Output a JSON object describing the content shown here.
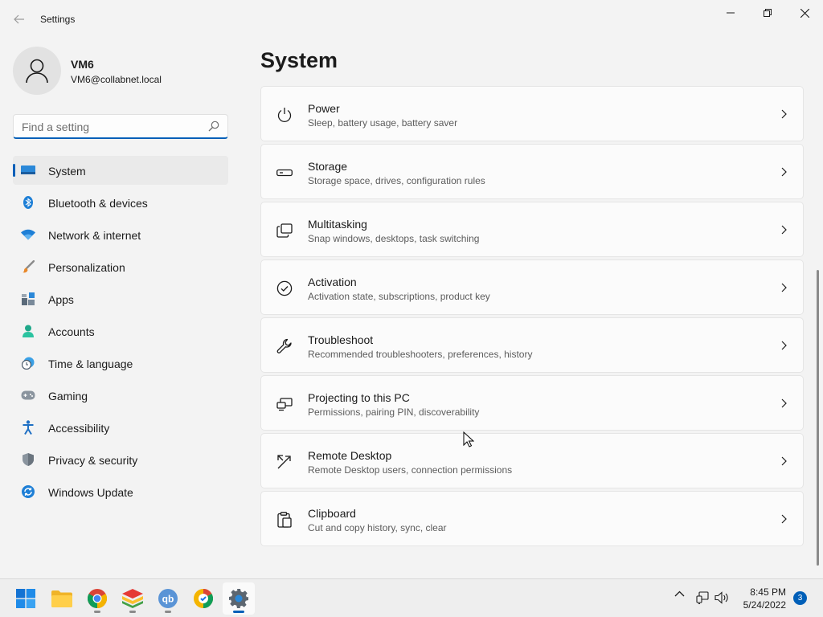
{
  "window": {
    "title": "Settings",
    "controls": {
      "minimize_icon": "minimize-icon",
      "maximize_icon": "restore-icon",
      "close_icon": "close-icon"
    }
  },
  "profile": {
    "name": "VM6",
    "email": "VM6@collabnet.local"
  },
  "search": {
    "placeholder": "Find a setting",
    "value": ""
  },
  "sidebar": {
    "selected_index": 0,
    "items": [
      {
        "label": "System",
        "icon": "system-icon"
      },
      {
        "label": "Bluetooth & devices",
        "icon": "bluetooth-icon"
      },
      {
        "label": "Network & internet",
        "icon": "wifi-icon"
      },
      {
        "label": "Personalization",
        "icon": "brush-icon"
      },
      {
        "label": "Apps",
        "icon": "apps-icon"
      },
      {
        "label": "Accounts",
        "icon": "account-icon"
      },
      {
        "label": "Time & language",
        "icon": "clock-globe-icon"
      },
      {
        "label": "Gaming",
        "icon": "gamepad-icon"
      },
      {
        "label": "Accessibility",
        "icon": "accessibility-icon"
      },
      {
        "label": "Privacy & security",
        "icon": "shield-icon"
      },
      {
        "label": "Windows Update",
        "icon": "update-icon"
      }
    ]
  },
  "main": {
    "title": "System",
    "cards": [
      {
        "title": "Power",
        "description": "Sleep, battery usage, battery saver",
        "icon": "power-icon"
      },
      {
        "title": "Storage",
        "description": "Storage space, drives, configuration rules",
        "icon": "storage-icon"
      },
      {
        "title": "Multitasking",
        "description": "Snap windows, desktops, task switching",
        "icon": "multitasking-icon"
      },
      {
        "title": "Activation",
        "description": "Activation state, subscriptions, product key",
        "icon": "check-circle-icon"
      },
      {
        "title": "Troubleshoot",
        "description": "Recommended troubleshooters, preferences, history",
        "icon": "wrench-icon"
      },
      {
        "title": "Projecting to this PC",
        "description": "Permissions, pairing PIN, discoverability",
        "icon": "projecting-icon"
      },
      {
        "title": "Remote Desktop",
        "description": "Remote Desktop users, connection permissions",
        "icon": "remote-desktop-icon"
      },
      {
        "title": "Clipboard",
        "description": "Cut and copy history, sync, clear",
        "icon": "clipboard-icon"
      }
    ]
  },
  "taskbar": {
    "apps": [
      {
        "name": "start",
        "icon": "windows-start-icon"
      },
      {
        "name": "file-explorer",
        "icon": "folder-icon"
      },
      {
        "name": "chrome",
        "icon": "chrome-icon"
      },
      {
        "name": "bluestacks",
        "icon": "bluestacks-icon"
      },
      {
        "name": "qbittorrent",
        "icon": "qbittorrent-icon"
      },
      {
        "name": "browser",
        "icon": "browser-icon"
      },
      {
        "name": "settings",
        "icon": "gear-icon"
      }
    ],
    "clock": {
      "time": "8:45 PM",
      "date": "5/24/2022"
    },
    "notification_count": "3"
  },
  "colors": {
    "accent": "#005fb8",
    "background": "#f3f3f3",
    "card": "#fbfbfb"
  }
}
